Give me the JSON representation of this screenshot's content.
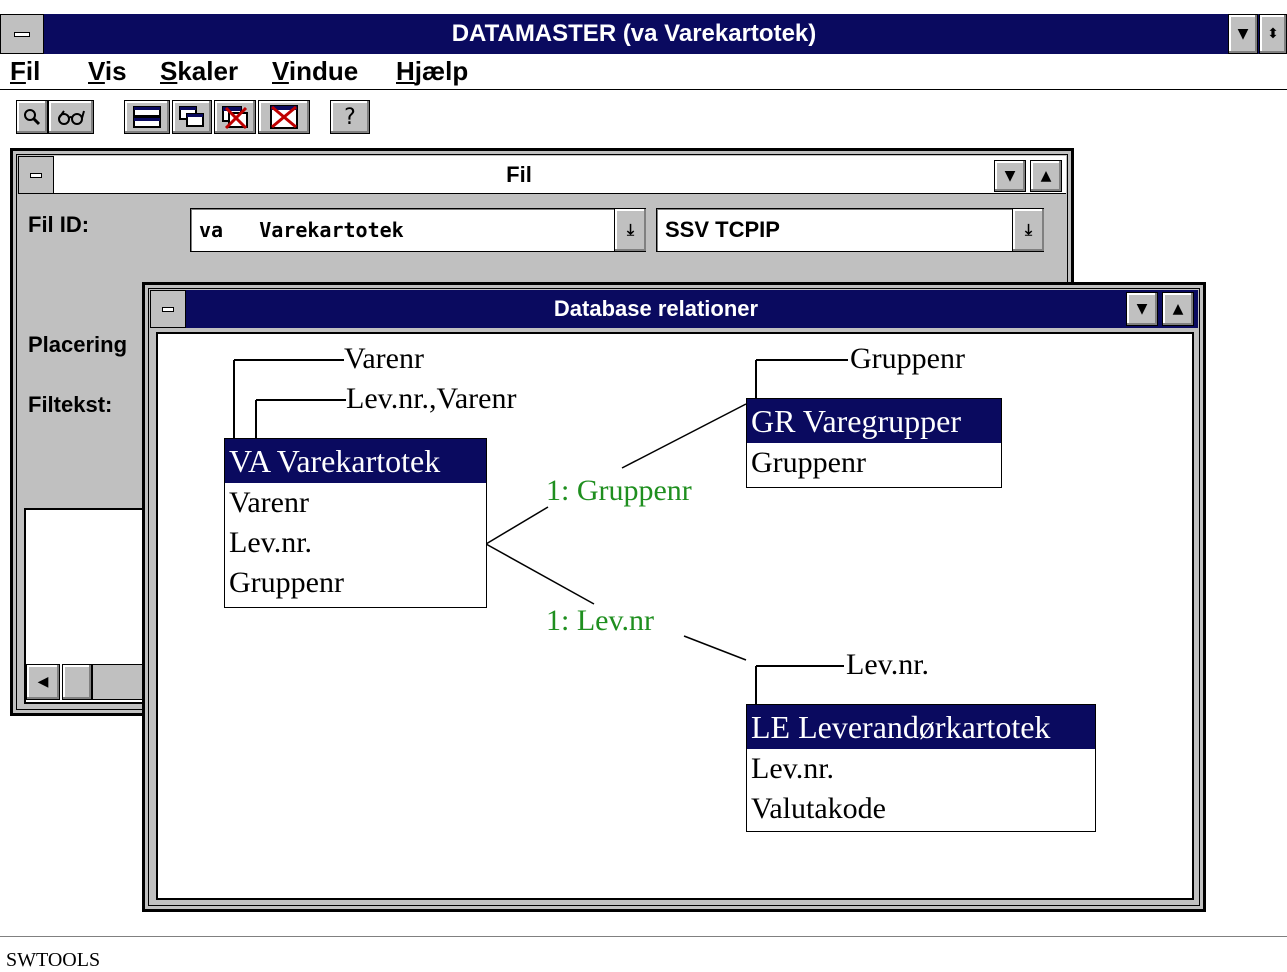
{
  "app": {
    "title": "DATAMASTER (va Varekartotek)",
    "menu": [
      {
        "label": "Fil",
        "mnemonic": "F",
        "rest": "il"
      },
      {
        "label": "Vis",
        "mnemonic": "V",
        "rest": "is"
      },
      {
        "label": "Skaler",
        "mnemonic": "S",
        "rest": "kaler"
      },
      {
        "label": "Vindue",
        "mnemonic": "V",
        "rest": "indue"
      },
      {
        "label": "Hjælp",
        "mnemonic": "H",
        "rest": "jælp"
      }
    ],
    "toolbar": {
      "icons": [
        "magnifier-icon",
        "glasses-icon",
        "tile-windows-icon",
        "cascade-windows-icon",
        "close-window-icon",
        "close-all-icon",
        "help-icon"
      ],
      "help_glyph": "?"
    },
    "status_text": "SWTOOLS"
  },
  "fil_window": {
    "title": "Fil",
    "fil_id_label": "Fil ID:",
    "fil_id_value": "va   Varekartotek",
    "server_value": "SSV TCPIP",
    "placering_label": "Placering",
    "filtekst_label": "Filtekst:"
  },
  "relations_window": {
    "title": "Database relationer",
    "tables": [
      {
        "name": "VA Varekartotek",
        "fields": [
          "Varenr",
          "Lev.nr.",
          "Gruppenr"
        ]
      },
      {
        "name": "GR Varegrupper",
        "fields": [
          "Gruppenr"
        ]
      },
      {
        "name": "LE Leverandørkartotek",
        "fields": [
          "Lev.nr.",
          "Valutakode"
        ]
      }
    ],
    "keys": {
      "va_key1": "Varenr",
      "va_key2": "Lev.nr.,Varenr",
      "gr_key": "Gruppenr",
      "le_key": "Lev.nr."
    },
    "relations": [
      "1: Gruppenr",
      "1: Lev.nr"
    ]
  },
  "colors": {
    "titlebar": "#0a0a5f",
    "relation_text": "#1f8f1f",
    "chrome": "#c0c0c0"
  }
}
